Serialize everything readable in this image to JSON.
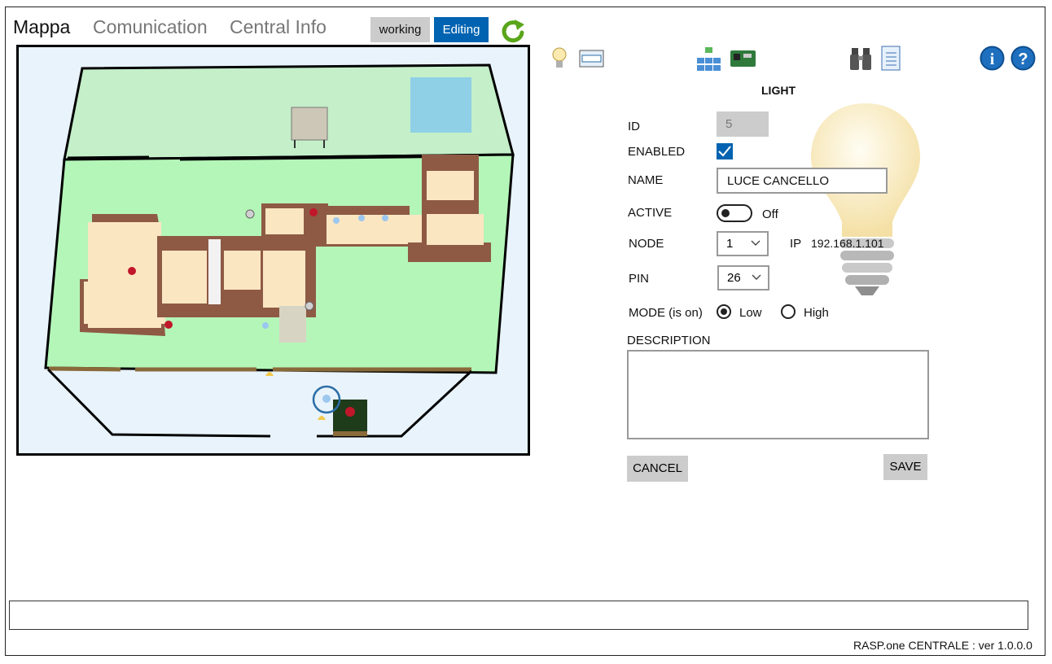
{
  "tabs": [
    {
      "label": "Mappa",
      "active": true
    },
    {
      "label": "Comunication",
      "active": false
    },
    {
      "label": "Central Info",
      "active": false
    }
  ],
  "mode_buttons": {
    "working": "working",
    "editing": "Editing"
  },
  "colors": {
    "accent": "#0063b1",
    "button_gray": "#cccccc",
    "refresh_green": "#5aa51a",
    "info_blue": "#1f6fbf"
  },
  "toolbar_icons": [
    "light-bulb-icon",
    "display-icon",
    "network-icon",
    "raspberry-board-icon",
    "binoculars-icon",
    "notebook-icon",
    "info-icon",
    "help-icon"
  ],
  "form": {
    "title": "LIGHT",
    "id_label": "ID",
    "id_value": "5",
    "enabled_label": "ENABLED",
    "enabled_checked": true,
    "name_label": "NAME",
    "name_value": "LUCE CANCELLO",
    "active_label": "ACTIVE",
    "active_state": "Off",
    "node_label": "NODE",
    "node_value": "1",
    "ip_label": "IP",
    "ip_value": "192.168.1.101",
    "pin_label": "PIN",
    "pin_value": "26",
    "mode_label": "MODE (is on)",
    "mode_options": [
      "Low",
      "High"
    ],
    "mode_selected": "Low",
    "description_label": "DESCRIPTION",
    "description_value": "",
    "cancel_label": "CANCEL",
    "save_label": "SAVE"
  },
  "status_input_value": "",
  "footer": "RASP.one CENTRALE : ver 1.0.0.0"
}
